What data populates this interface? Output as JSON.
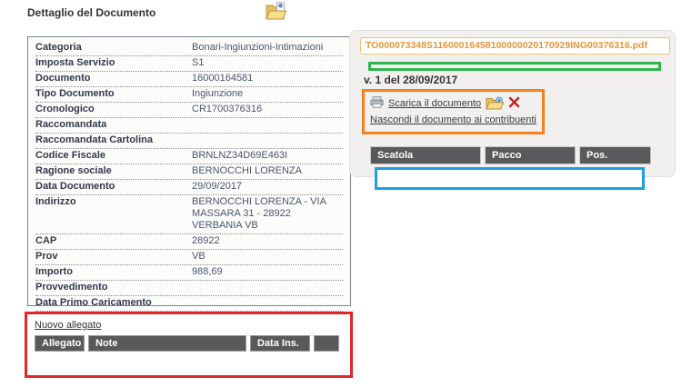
{
  "page": {
    "title": "Dettaglio del Documento"
  },
  "detail": {
    "rows": [
      {
        "label": "Categoria",
        "value": "Bonari-Ingiunzioni-Intimazioni"
      },
      {
        "label": "Imposta Servizio",
        "value": "S1"
      },
      {
        "label": "Documento",
        "value": "16000164581"
      },
      {
        "label": "Tipo Documento",
        "value": "Ingiunzione"
      },
      {
        "label": "Cronologico",
        "value": "CR1700376316"
      },
      {
        "label": "Raccomandata",
        "value": ""
      },
      {
        "label": "Raccomandata Cartolina",
        "value": ""
      },
      {
        "label": "Codice Fiscale",
        "value": "BRNLNZ34D69E463I"
      },
      {
        "label": "Ragione sociale",
        "value": "BERNOCCHI LORENZA"
      },
      {
        "label": "Data Documento",
        "value": "29/09/2017"
      },
      {
        "label": "Indirizzo",
        "value": "BERNOCCHI LORENZA - VIA MASSARA 31 - 28922 VERBANIA VB"
      },
      {
        "label": "CAP",
        "value": "28922"
      },
      {
        "label": "Prov",
        "value": "VB"
      },
      {
        "label": "Importo",
        "value": "988,69"
      },
      {
        "label": "Provvedimento",
        "value": ""
      },
      {
        "label": "Data Primo Caricamento",
        "value": ""
      }
    ]
  },
  "attachments": {
    "new_link_label": "Nuovo allegato",
    "headers": [
      "Allegato",
      "Note",
      "Data Ins.",
      ""
    ]
  },
  "document_panel": {
    "filename": "TO000073348S11600016458100000020170929ING00376316.pdf",
    "version_label": "v. 1 del 28/09/2017",
    "download_link_label": "Scarica il documento",
    "hide_link_label": "Nascondi il documento ai contribuenti",
    "storage_headers": [
      "Scatola",
      "Pacco",
      "Pos."
    ]
  },
  "icons": {
    "title_icon": "folder-search-icon",
    "download_icon": "printer-icon",
    "open_icon": "folder-go-icon",
    "delete_icon": "delete-x-icon"
  },
  "colors": {
    "annotation_red": "#e5252a",
    "annotation_orange": "#f58220",
    "annotation_green": "#2eb44d",
    "annotation_blue": "#1f9fdf",
    "header_bg": "#59595b",
    "filename_text": "#e2973a",
    "filename_border": "#f2c467",
    "panel_bg": "#f1f0ee"
  }
}
